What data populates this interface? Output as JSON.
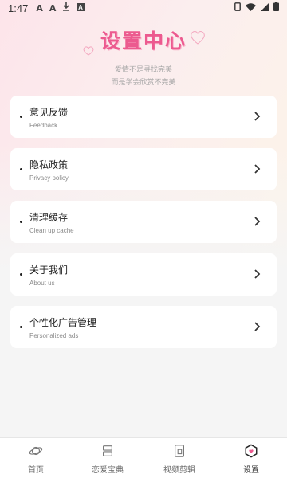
{
  "status_bar": {
    "time": "1:47",
    "left_icons": [
      "font-a-icon",
      "font-a-icon",
      "download-icon",
      "font-box-icon"
    ],
    "right_icons": [
      "sim-icon",
      "wifi-icon",
      "signal-icon",
      "battery-icon"
    ]
  },
  "hero": {
    "title": "设置中心",
    "line1": "爱情不是寻找完美",
    "line2": "而是学会欣赏不完美"
  },
  "menu": [
    {
      "title": "意见反馈",
      "subtitle": "Feedback"
    },
    {
      "title": "隐私政策",
      "subtitle": "Privacy policy"
    },
    {
      "title": "清理缓存",
      "subtitle": "Clean up cache"
    },
    {
      "title": "关于我们",
      "subtitle": "About us"
    },
    {
      "title": "个性化广告管理",
      "subtitle": "Personalized ads"
    }
  ],
  "bottom_nav": [
    {
      "label": "首页",
      "icon": "planet-icon",
      "active": false
    },
    {
      "label": "恋爱宝典",
      "icon": "book-icon",
      "active": false
    },
    {
      "label": "视频剪辑",
      "icon": "video-edit-icon",
      "active": false
    },
    {
      "label": "设置",
      "icon": "settings-hex-icon",
      "active": true
    }
  ],
  "colors": {
    "accent": "#ec5a8f",
    "background": "#f5f5f5"
  }
}
